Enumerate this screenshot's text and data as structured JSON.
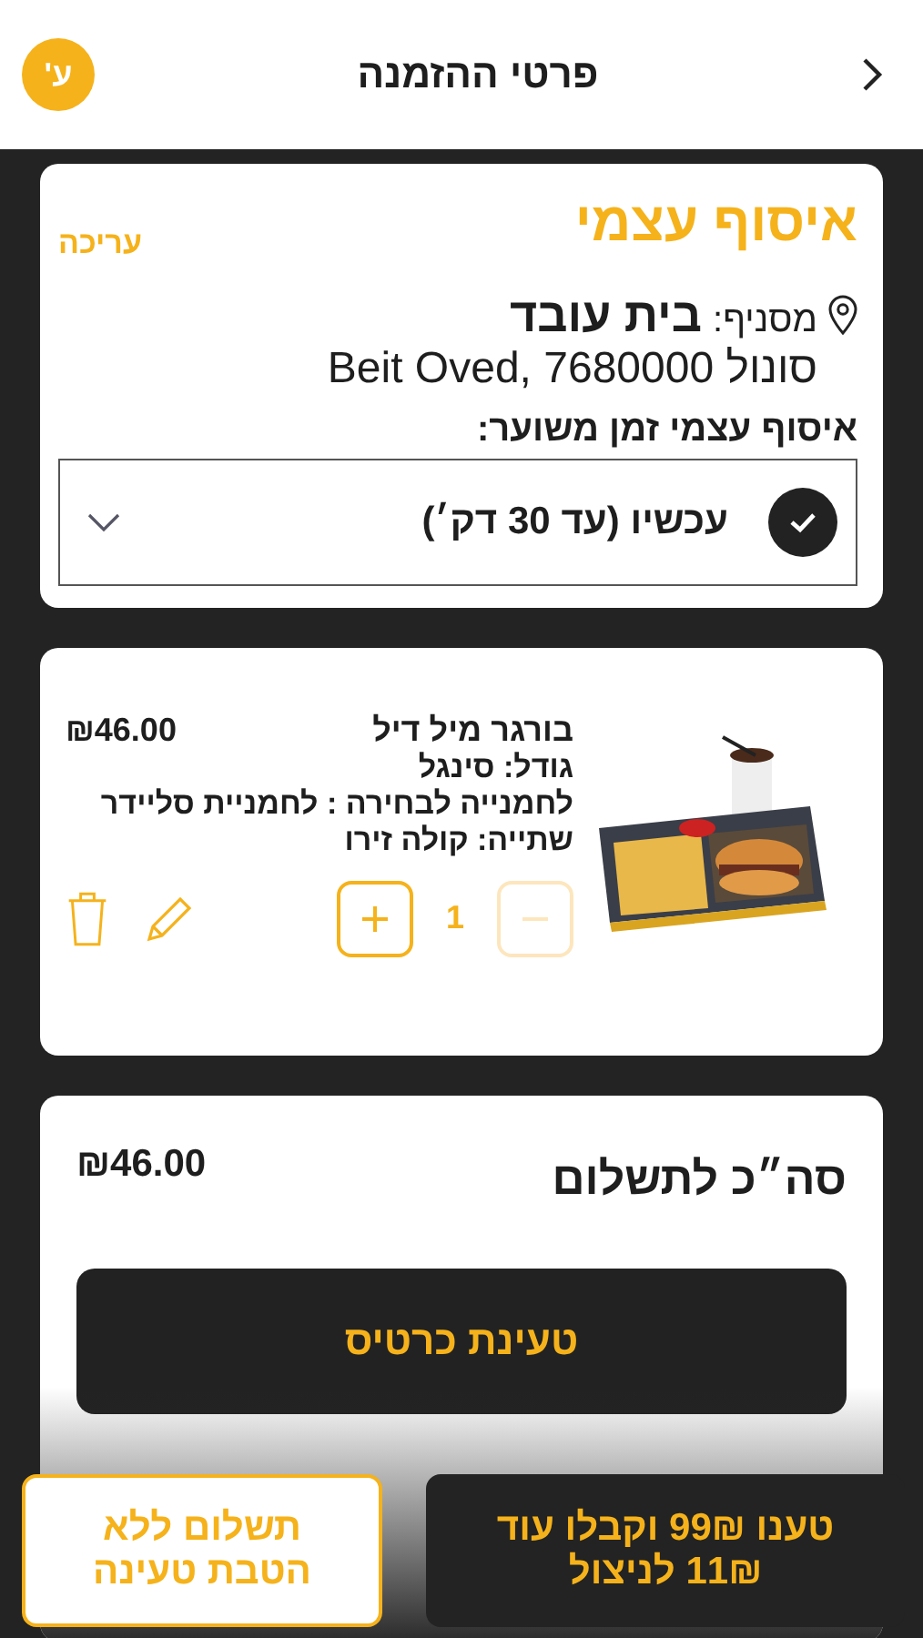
{
  "header": {
    "title": "פרטי ההזמנה",
    "avatar": "ע'"
  },
  "pickup": {
    "title": "איסוף עצמי",
    "edit": "עריכה",
    "branch_label": "מסניף:",
    "branch_name": "בית עובד",
    "address": "Beit Oved, 7680000 סונול",
    "time_label": "איסוף עצמי זמן משוער:",
    "time_option": {
      "text": "עכשיו (עד 30 דק׳)",
      "checked": true
    }
  },
  "cart": [
    {
      "name": "בורגר מיל דיל",
      "price": "₪46.00",
      "options": [
        "גודל: סינגל",
        "לחמנייה לבחירה : לחמניית סליידר",
        "שתייה: קולה זירו"
      ],
      "quantity": "1",
      "minus_disabled": true
    }
  ],
  "summary": {
    "label": "סה״כ לתשלום",
    "total": "₪46.00",
    "button": "טעינת כרטיס"
  },
  "bottom_buttons": [
    {
      "kind": "filled",
      "lines": [
        "טענו 99₪ וקבלו עוד",
        "11₪ לניצול"
      ]
    },
    {
      "kind": "outline",
      "lines": [
        "תשלום ללא",
        "הטבת טעינה"
      ]
    }
  ]
}
